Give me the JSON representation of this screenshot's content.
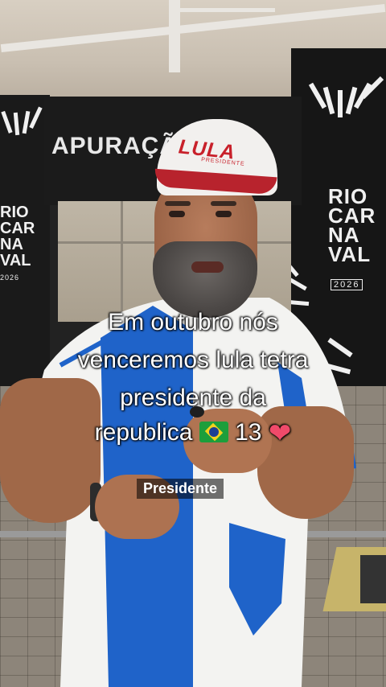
{
  "background": {
    "banner_text": "APURAÇÃO 2026",
    "logo_right_lines": [
      "RIO",
      "CAR",
      "NA",
      "VAL"
    ],
    "logo_right_year": "2026",
    "logo_left_lines": [
      "RIO",
      "CAR",
      "NA",
      "VAL"
    ],
    "logo_left_year": "2026"
  },
  "cap": {
    "brand": "LULA",
    "sub": "PRESIDENTE",
    "colors": {
      "crown": "#f2f0ee",
      "brim": "#b8232d",
      "text": "#c8202a"
    }
  },
  "caption": {
    "line1": "Em outubro nós",
    "line2": "venceremos lula tetra",
    "line3": "presidente da",
    "line4_text": "republica",
    "line4_flag": "brazil-flag-emoji",
    "line4_number": "13",
    "line4_heart": "❤"
  },
  "subtitle": "Presidente",
  "colors": {
    "shirt_blue": "#1f63c9",
    "shirt_white": "#f3f3f1",
    "caption": "#ffffff"
  }
}
